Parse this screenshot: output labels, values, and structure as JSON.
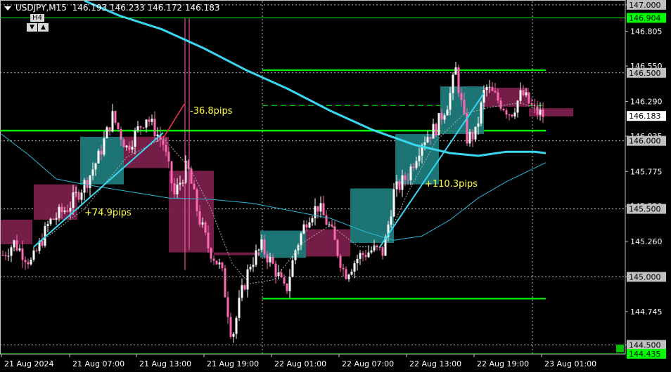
{
  "title": {
    "symbol": "USDJPY,M15",
    "ohlc": "146.193 146.233 146.172 146.183"
  },
  "timeframe_widget": {
    "label": "H4",
    "down_icon": "triangle-down-icon",
    "up_icon": "triangle-up-icon"
  },
  "colors": {
    "background": "#000000",
    "bull_candle": "#ffffff",
    "bear_candle": "#ff69b4",
    "bull_box": "#1f7a7a",
    "bear_box": "#7a1f4a",
    "level_line": "#00ff00",
    "ma_slow": "#3ad7f0",
    "ma_mid": "#2bb7d0",
    "annotation_text": "#ffff40",
    "grid": "#c0c0c0"
  },
  "chart_data": {
    "type": "candlestick",
    "y_axis": {
      "ticks": [
        "147.000",
        "146.805",
        "146.550",
        "146.290",
        "146.035",
        "145.775",
        "145.520",
        "145.260",
        "145.000",
        "144.745",
        "144.500"
      ],
      "range": [
        144.435,
        147.025
      ]
    },
    "x_axis": {
      "ticks": [
        "21 Aug 2024",
        "21 Aug 07:00",
        "21 Aug 13:00",
        "21 Aug 19:00",
        "22 Aug 01:00",
        "22 Aug 07:00",
        "22 Aug 13:00",
        "22 Aug 19:00",
        "23 Aug 01:00"
      ]
    },
    "price_labels": [
      {
        "value": "147.000",
        "style": "grey"
      },
      {
        "value": "146.904",
        "style": "green"
      },
      {
        "value": "146.500",
        "style": "grey"
      },
      {
        "value": "146.183",
        "style": "white"
      },
      {
        "value": "146.000",
        "style": "grey"
      },
      {
        "value": "145.500",
        "style": "grey"
      },
      {
        "value": "145.000",
        "style": "grey"
      },
      {
        "value": "144.500",
        "style": "grey"
      },
      {
        "value": "144.435",
        "style": "green"
      }
    ],
    "annotations": [
      {
        "text": "-36.8pips"
      },
      {
        "text": "+74.9pips"
      },
      {
        "text": "+110.3pips"
      }
    ]
  }
}
